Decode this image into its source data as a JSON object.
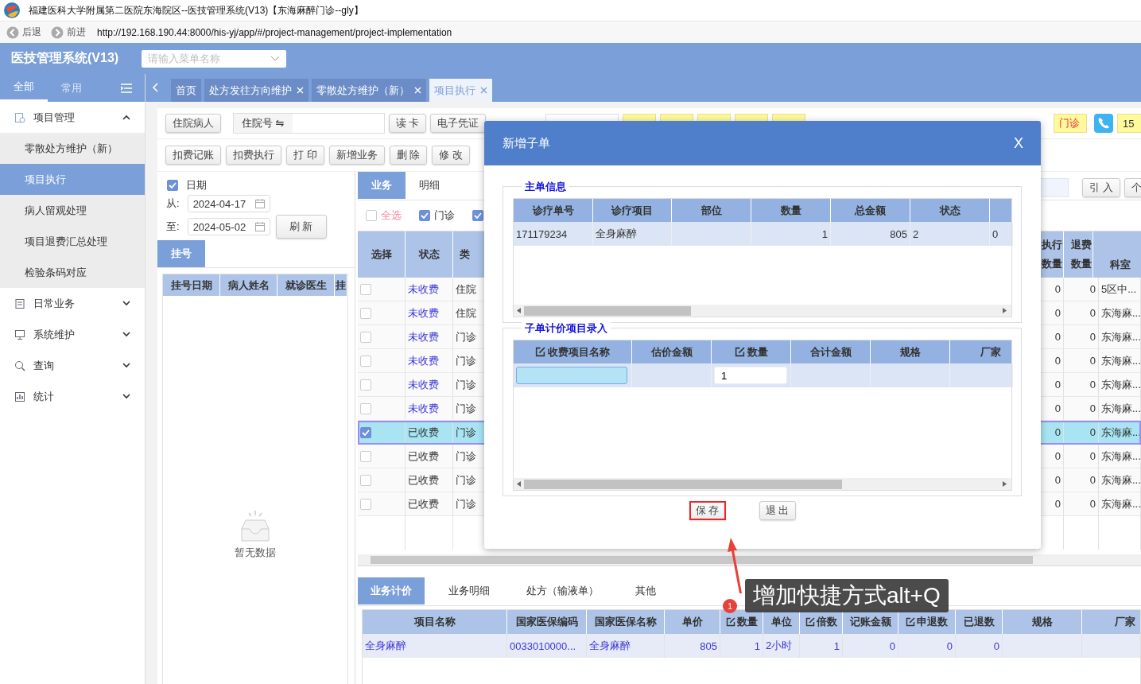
{
  "window": {
    "title": "福建医科大学附属第二医院东海院区--医技管理系统(V13)【东海麻醉门诊--gly】"
  },
  "browser": {
    "back": "后退",
    "forward": "前进",
    "url": "http://192.168.190.44:8000/his-yj/app/#/project-management/project-implementation"
  },
  "header": {
    "app_title": "医技管理系统(V13)",
    "menu_search": {
      "placeholder": "请输入菜单名称"
    }
  },
  "sidebar": {
    "tabs": [
      {
        "label": "全部",
        "selected": true
      },
      {
        "label": "常用",
        "selected": false
      }
    ],
    "items": [
      {
        "label": "项目管理",
        "expanded": true,
        "children": [
          {
            "label": "零散处方维护（新）",
            "selected": false
          },
          {
            "label": "项目执行",
            "selected": true
          },
          {
            "label": "病人留观处理",
            "selected": false
          },
          {
            "label": "项目退费汇总处理",
            "selected": false
          },
          {
            "label": "检验条码对应",
            "selected": false
          }
        ]
      },
      {
        "label": "日常业务",
        "expanded": false
      },
      {
        "label": "系统维护",
        "expanded": false
      },
      {
        "label": "查询",
        "expanded": false
      },
      {
        "label": "统计",
        "expanded": false
      }
    ]
  },
  "page_tabs": [
    {
      "label": "首页",
      "closable": false,
      "selected": false
    },
    {
      "label": "处方发往方向维护",
      "closable": true,
      "selected": false
    },
    {
      "label": "零散处方维护（新）",
      "closable": true,
      "selected": false
    },
    {
      "label": "项目执行",
      "closable": true,
      "selected": true
    }
  ],
  "toolbar_1": [
    {
      "kind": "button",
      "label": "住院病人"
    },
    {
      "kind": "field",
      "label": "住院号 ⇋"
    },
    {
      "kind": "button",
      "label": "读 卡"
    },
    {
      "kind": "button",
      "label": "电子凭证"
    },
    {
      "kind": "select"
    },
    {
      "kind": "tag"
    },
    {
      "kind": "tag"
    },
    {
      "kind": "tag"
    },
    {
      "kind": "tag"
    },
    {
      "kind": "tag"
    },
    {
      "kind": "alert_tag",
      "value": "门诊"
    },
    {
      "kind": "phone"
    },
    {
      "kind": "tag",
      "value": "15"
    }
  ],
  "toolbar_2": [
    "扣费记账",
    "扣费执行",
    "打 印",
    "新增业务",
    "删 除",
    "修 改"
  ],
  "toolbar_right": [
    "引 入",
    "个"
  ],
  "date_filter": {
    "checked": true,
    "label": "日期",
    "from_label": "从:",
    "from": "2024-04-17",
    "to_label": "至:",
    "to": "2024-05-02",
    "refresh": "刷 新"
  },
  "registration": {
    "tabs": [
      {
        "label": "挂号",
        "selected": true
      }
    ],
    "columns": [
      "挂号日期",
      "病人姓名",
      "就诊医生",
      "挂"
    ],
    "empty_text": "暂无数据"
  },
  "business": {
    "tabs": [
      {
        "label": "业务",
        "selected": true
      },
      {
        "label": "明细",
        "selected": false
      }
    ],
    "filters": [
      {
        "label": "全选",
        "checked": false
      },
      {
        "label": "门诊",
        "checked": true
      },
      {
        "checked": true
      }
    ],
    "columns": [
      "选择",
      "状态",
      "类",
      "执行数量",
      "退费数量",
      "科室"
    ],
    "rows": [
      {
        "selected": false,
        "paid": false,
        "status": "未收费",
        "category": "住院",
        "exec": "0",
        "refund": "0",
        "dept": "5区中..."
      },
      {
        "selected": false,
        "paid": false,
        "status": "未收费",
        "category": "住院",
        "exec": "0",
        "refund": "0",
        "dept": "东海麻..."
      },
      {
        "selected": false,
        "paid": false,
        "status": "未收费",
        "category": "门诊",
        "exec": "0",
        "refund": "0",
        "dept": "东海麻..."
      },
      {
        "selected": false,
        "paid": false,
        "status": "未收费",
        "category": "门诊",
        "exec": "0",
        "refund": "0",
        "dept": "东海麻..."
      },
      {
        "selected": false,
        "paid": false,
        "status": "未收费",
        "category": "门诊",
        "exec": "0",
        "refund": "0",
        "dept": "东海麻..."
      },
      {
        "selected": false,
        "paid": false,
        "status": "未收费",
        "category": "门诊",
        "exec": "0",
        "refund": "0",
        "dept": "东海麻..."
      },
      {
        "selected": true,
        "paid": true,
        "status": "已收费",
        "category": "门诊",
        "exec": "0",
        "refund": "0",
        "dept": "东海麻..."
      },
      {
        "selected": false,
        "paid": true,
        "status": "已收费",
        "category": "门诊",
        "exec": "0",
        "refund": "0",
        "dept": "东海麻..."
      },
      {
        "selected": false,
        "paid": true,
        "status": "已收费",
        "category": "门诊",
        "exec": "0",
        "refund": "0",
        "dept": "东海麻..."
      },
      {
        "selected": false,
        "paid": true,
        "status": "已收费",
        "category": "门诊",
        "exec": "0",
        "refund": "0",
        "dept": "东海麻..."
      }
    ]
  },
  "pricing": {
    "tabs": [
      {
        "label": "业务计价",
        "selected": true
      },
      {
        "label": "业务明细",
        "selected": false
      },
      {
        "label": "处方（输液单）",
        "selected": false
      },
      {
        "label": "其他",
        "selected": false
      }
    ],
    "columns": [
      {
        "label": "项目名称",
        "editable": false
      },
      {
        "label": "国家医保编码",
        "editable": false
      },
      {
        "label": "国家医保名称",
        "editable": false
      },
      {
        "label": "单价",
        "editable": false
      },
      {
        "label": "数量",
        "editable": true
      },
      {
        "label": "单位",
        "editable": false
      },
      {
        "label": "倍数",
        "editable": true
      },
      {
        "label": "记账金额",
        "editable": false
      },
      {
        "label": "申退数",
        "editable": true
      },
      {
        "label": "已退数",
        "editable": false
      },
      {
        "label": "规格",
        "editable": false
      },
      {
        "label": "厂家",
        "editable": false
      }
    ],
    "rows": [
      [
        "全身麻醉",
        "0033010000...",
        "全身麻醉",
        "805",
        "1",
        "2小时",
        "1",
        "0",
        "0",
        "0",
        null,
        null
      ]
    ]
  },
  "dialog": {
    "title": "新增子单",
    "close": "X",
    "main_info": {
      "legend": "主单信息",
      "columns": [
        "诊疗单号",
        "诊疗项目",
        "部位",
        "数量",
        "总金额",
        "状态"
      ],
      "rows": [
        [
          "171179234",
          "全身麻醉",
          null,
          "1",
          "805",
          "2",
          "0"
        ]
      ]
    },
    "sub_items": {
      "legend": "子单计价项目录入",
      "columns": [
        {
          "label": "收费项目名称",
          "editable": true
        },
        {
          "label": "估价金额",
          "editable": false
        },
        {
          "label": "数量",
          "editable": true
        },
        {
          "label": "合计金额",
          "editable": false
        },
        {
          "label": "规格",
          "editable": false
        },
        {
          "label": "厂家",
          "editable": false
        }
      ],
      "row": {
        "quantity": "1"
      }
    },
    "buttons": [
      {
        "label": "保 存",
        "highlighted": true
      },
      {
        "label": "退 出",
        "highlighted": false
      }
    ]
  },
  "annotation": {
    "badge": "1",
    "text": "增加快捷方式alt+Q"
  }
}
